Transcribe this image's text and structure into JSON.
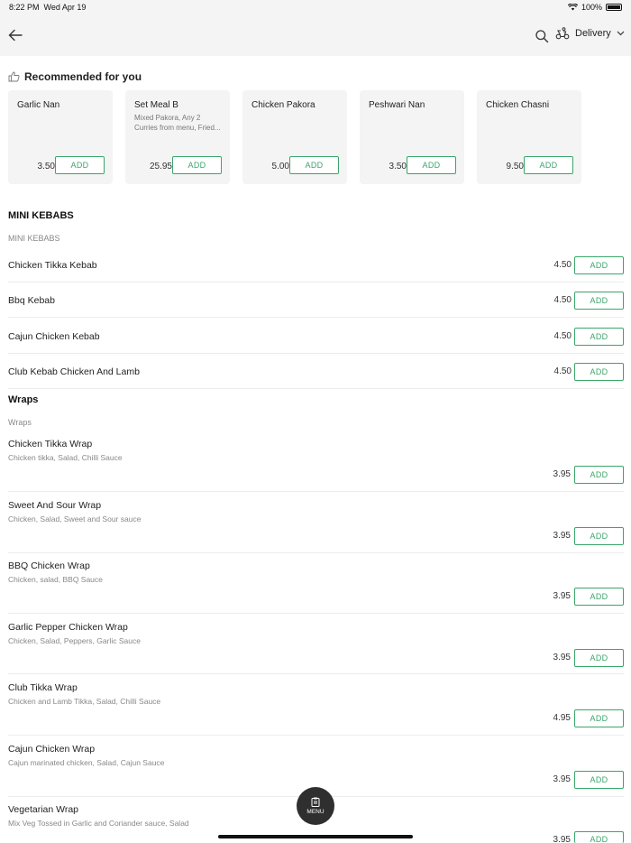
{
  "status": {
    "time": "8:22 PM",
    "date": "Wed Apr 19",
    "battery": "100%"
  },
  "header": {
    "delivery_label": "Delivery"
  },
  "recommended": {
    "title": "Recommended for you",
    "items": [
      {
        "name": "Garlic Nan",
        "desc": "",
        "price": "3.50",
        "add": "ADD"
      },
      {
        "name": "Set Meal B",
        "desc": "Mixed Pakora, Any 2 Curries from menu, Fried...",
        "price": "25.95",
        "add": "ADD"
      },
      {
        "name": "Chicken Pakora",
        "desc": "",
        "price": "5.00",
        "add": "ADD"
      },
      {
        "name": "Peshwari Nan",
        "desc": "",
        "price": "3.50",
        "add": "ADD"
      },
      {
        "name": "Chicken Chasni",
        "desc": "",
        "price": "9.50",
        "add": "ADD"
      }
    ]
  },
  "mini_kebabs": {
    "title": "MINI KEBABS",
    "subtitle": "MINI KEBABS",
    "items": [
      {
        "name": "Chicken Tikka Kebab",
        "price": "4.50",
        "add": "ADD"
      },
      {
        "name": "Bbq Kebab",
        "price": "4.50",
        "add": "ADD"
      },
      {
        "name": "Cajun Chicken Kebab",
        "price": "4.50",
        "add": "ADD"
      },
      {
        "name": "Club Kebab Chicken And Lamb",
        "price": "4.50",
        "add": "ADD"
      }
    ]
  },
  "wraps": {
    "title": "Wraps",
    "subtitle": "Wraps",
    "items": [
      {
        "name": "Chicken Tikka Wrap",
        "desc": "Chicken tikka, Salad, Chilli Sauce",
        "price": "3.95",
        "add": "ADD"
      },
      {
        "name": "Sweet And Sour Wrap",
        "desc": "Chicken, Salad, Sweet and Sour sauce",
        "price": "3.95",
        "add": "ADD"
      },
      {
        "name": "BBQ Chicken Wrap",
        "desc": "Chicken, salad, BBQ Sauce",
        "price": "3.95",
        "add": "ADD"
      },
      {
        "name": "Garlic Pepper Chicken Wrap",
        "desc": "Chicken, Salad, Peppers, Garlic Sauce",
        "price": "3.95",
        "add": "ADD"
      },
      {
        "name": "Club Tikka Wrap",
        "desc": "Chicken and Lamb Tikka, Salad, Chilli Sauce",
        "price": "4.95",
        "add": "ADD"
      },
      {
        "name": "Cajun Chicken Wrap",
        "desc": "Cajun marinated chicken, Salad, Cajun Sauce",
        "price": "3.95",
        "add": "ADD"
      },
      {
        "name": "Vegetarian Wrap",
        "desc": "Mix Veg Tossed in Garlic and Coriander sauce, Salad",
        "price": "3.95",
        "add": "ADD"
      }
    ]
  },
  "menu_button": {
    "label": "MENU"
  },
  "colors": {
    "accent": "#3aa66a",
    "header_bg": "#f4f4f4",
    "fab_bg": "#2f2f2f"
  }
}
